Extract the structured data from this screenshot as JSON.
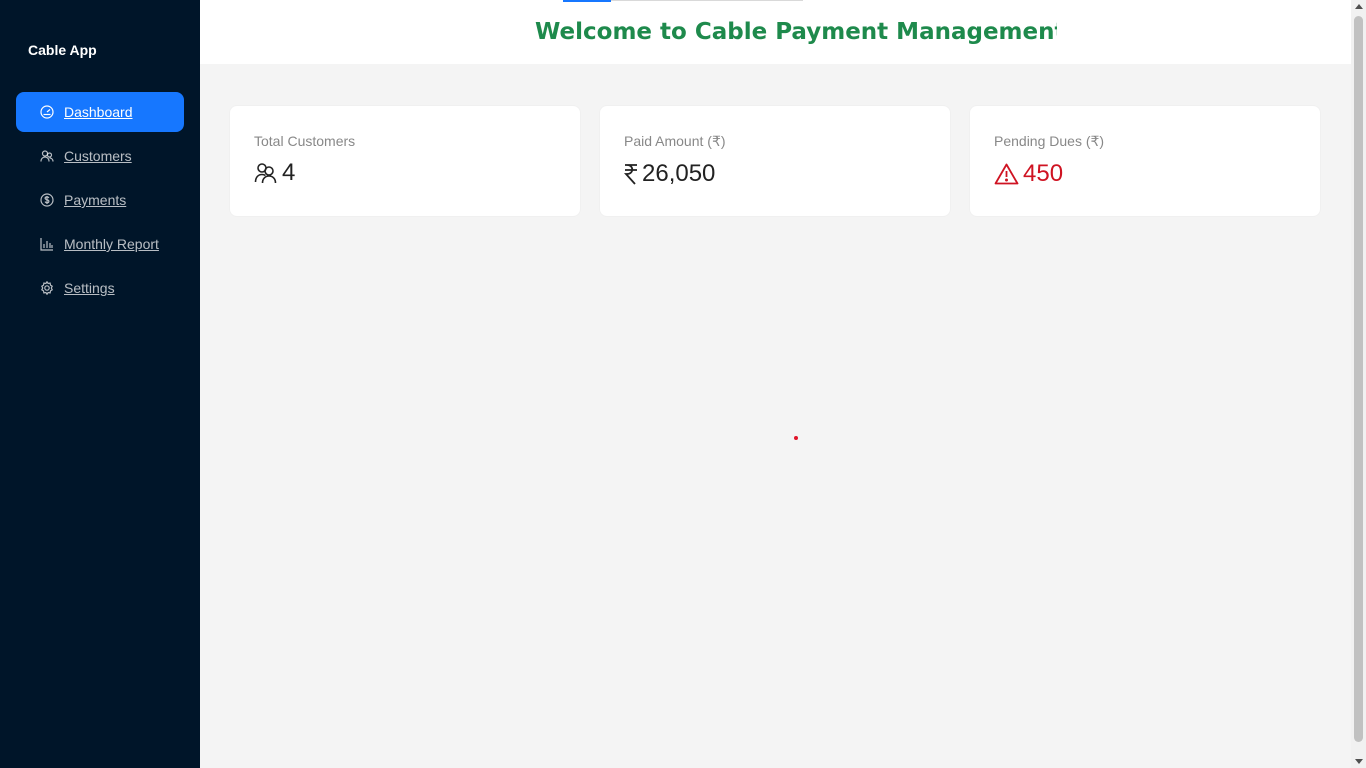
{
  "app": {
    "brand": "Cable App"
  },
  "sidebar": {
    "items": [
      {
        "label": "Dashboard",
        "icon": "dashboard-icon",
        "active": true
      },
      {
        "label": "Customers",
        "icon": "users-icon",
        "active": false
      },
      {
        "label": "Payments",
        "icon": "dollar-circle-icon",
        "active": false
      },
      {
        "label": "Monthly Report",
        "icon": "bar-chart-icon",
        "active": false
      },
      {
        "label": "Settings",
        "icon": "gear-icon",
        "active": false
      }
    ]
  },
  "header": {
    "title": "Welcome to Cable Payment Management System"
  },
  "stats": [
    {
      "title": "Total Customers",
      "value": "4",
      "icon": "users-icon"
    },
    {
      "title": "Paid Amount (₹)",
      "value": "26,050",
      "icon": "rupee-icon"
    },
    {
      "title": "Pending Dues (₹)",
      "value": "450",
      "icon": "warning-icon",
      "color": "#cf1322"
    }
  ],
  "colors": {
    "sidebar_bg": "#001529",
    "accent": "#1677ff",
    "title_green": "#1e8a4c",
    "danger": "#cf1322"
  }
}
